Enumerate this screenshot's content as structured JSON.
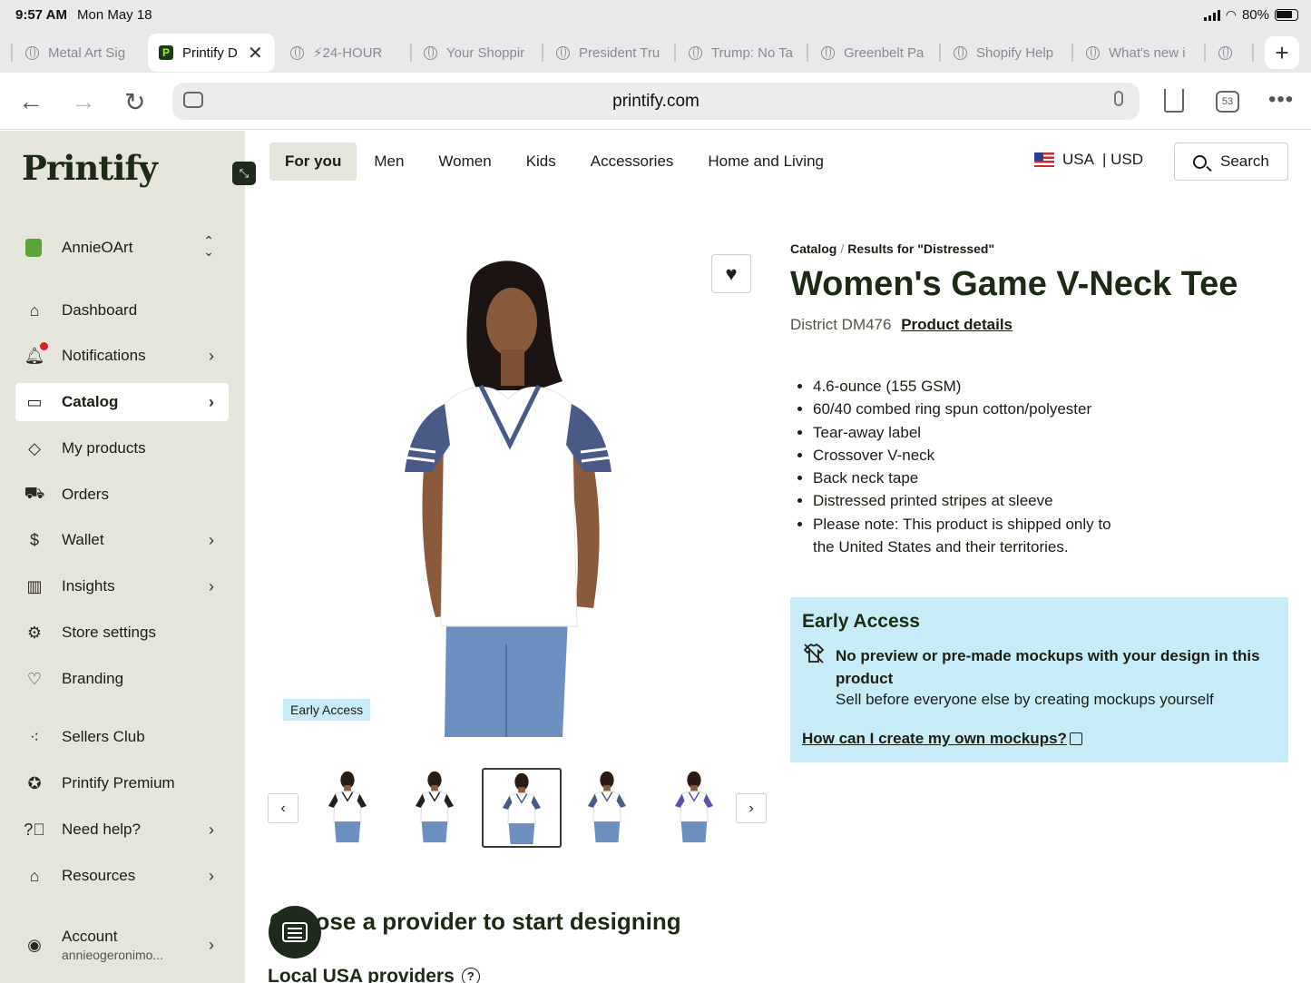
{
  "status": {
    "time": "9:57 AM",
    "date": "Mon May 18",
    "battery": "80%"
  },
  "tabs": [
    {
      "label": "Metal Art Sig"
    },
    {
      "label": "Printify D"
    },
    {
      "label": "⚡24-HOUR"
    },
    {
      "label": "Your Shoppir"
    },
    {
      "label": "President Tru"
    },
    {
      "label": "Trump: No Ta"
    },
    {
      "label": "Greenbelt Pa"
    },
    {
      "label": "Shopify Help"
    },
    {
      "label": "What's new i"
    }
  ],
  "browser": {
    "url": "printify.com",
    "tab_count": "53"
  },
  "sidebar": {
    "brand": "Printify",
    "store": "AnnieOArt",
    "items": [
      {
        "label": "Dashboard"
      },
      {
        "label": "Notifications"
      },
      {
        "label": "Catalog"
      },
      {
        "label": "My products"
      },
      {
        "label": "Orders"
      },
      {
        "label": "Wallet"
      },
      {
        "label": "Insights"
      },
      {
        "label": "Store settings"
      },
      {
        "label": "Branding"
      },
      {
        "label": "Sellers Club"
      },
      {
        "label": "Printify Premium"
      },
      {
        "label": "Need help?"
      },
      {
        "label": "Resources"
      }
    ],
    "account": {
      "label": "Account",
      "email": "annieogeronimo..."
    }
  },
  "topnav": {
    "categories": [
      "For you",
      "Men",
      "Women",
      "Kids",
      "Accessories",
      "Home and Living"
    ],
    "country": "USA",
    "currency": "| USD",
    "search_label": "Search"
  },
  "product": {
    "breadcrumb": {
      "root": "Catalog",
      "sep": "/",
      "current": "Results for \"Distressed\""
    },
    "title": "Women's Game V-Neck Tee",
    "model": "District DM476",
    "details_link": "Product details",
    "features": [
      "4.6-ounce (155 GSM)",
      "60/40 combed ring spun cotton/polyester",
      "Tear-away label",
      "Crossover V-neck",
      "Back neck tape",
      "Distressed printed stripes at sleeve",
      "Please note: This product is shipped only to the United States and their territories."
    ],
    "badge": "Early Access",
    "early_access": {
      "heading": "Early Access",
      "bold": "No preview or pre-made mockups with your design in this product",
      "text": "Sell before everyone else by creating mockups yourself",
      "link": "How can I create my own mockups?"
    },
    "thumbnail_count": 5,
    "selected_thumbnail": 3,
    "sleeve_colors": [
      "#1f1f24",
      "#1f1f24",
      "#4a5a86",
      "#4a5a86",
      "#5a4fb0"
    ]
  },
  "provider": {
    "heading": "Choose a provider to start designing",
    "local_heading": "Local USA providers"
  },
  "colors": {
    "accent": "#1d2a14",
    "sidebar_bg": "#e6e5db",
    "info_bg": "#c7ecf7",
    "notif_dot": "#d32222"
  }
}
